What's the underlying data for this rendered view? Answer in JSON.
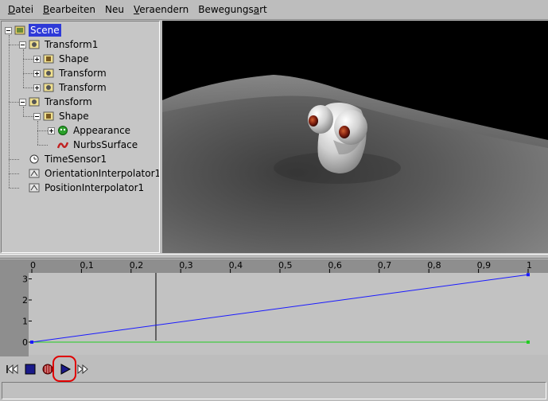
{
  "menu": [
    {
      "prefix": "",
      "accel": "D",
      "rest": "atei"
    },
    {
      "prefix": "",
      "accel": "B",
      "rest": "earbeiten"
    },
    {
      "prefix": "",
      "accel": "",
      "rest": "Neu"
    },
    {
      "prefix": "",
      "accel": "V",
      "rest": "eraendern"
    },
    {
      "prefix": "Bewegungs",
      "accel": "a",
      "rest": "rt"
    }
  ],
  "tree": [
    {
      "label": "Scene",
      "icon": "scene-icon",
      "expander": "minus",
      "selected": true
    },
    {
      "label": "Transform1",
      "icon": "transform-icon",
      "expander": "minus"
    },
    {
      "label": "Shape",
      "icon": "shape-icon",
      "expander": "plus"
    },
    {
      "label": "Transform",
      "icon": "transform-icon",
      "expander": "plus"
    },
    {
      "label": "Transform",
      "icon": "transform-icon",
      "expander": "plus"
    },
    {
      "label": "Transform",
      "icon": "transform-icon",
      "expander": "minus"
    },
    {
      "label": "Shape",
      "icon": "shape-icon",
      "expander": "minus"
    },
    {
      "label": "Appearance",
      "icon": "appearance-icon",
      "expander": "plus"
    },
    {
      "label": "NurbsSurface",
      "icon": "nurbs-surface-icon",
      "expander": "none"
    },
    {
      "label": "TimeSensor1",
      "icon": "time-sensor-icon",
      "expander": "none"
    },
    {
      "label": "OrientationInterpolator1",
      "icon": "interpolator-icon",
      "expander": "none"
    },
    {
      "label": "PositionInterpolator1",
      "icon": "interpolator-icon",
      "expander": "none"
    }
  ],
  "timeline": {
    "x_ticks": [
      "0",
      "0,1",
      "0,2",
      "0,3",
      "0,4",
      "0,5",
      "0,6",
      "0,7",
      "0,8",
      "0,9",
      "1"
    ],
    "y_ticks": [
      "0",
      "1",
      "2",
      "3"
    ],
    "cursor_time": 0.25,
    "blue_curve": {
      "color": "#1a1aff",
      "from": 0.0,
      "to": 3.2
    },
    "green_curve": {
      "color": "#22cc22",
      "from": 0.0,
      "to": 0.0
    }
  },
  "transport": {
    "buttons": [
      "rewind-icon",
      "stop-icon",
      "record-icon",
      "play-icon",
      "fast-forward-icon"
    ],
    "highlight_color": "#e00000"
  }
}
